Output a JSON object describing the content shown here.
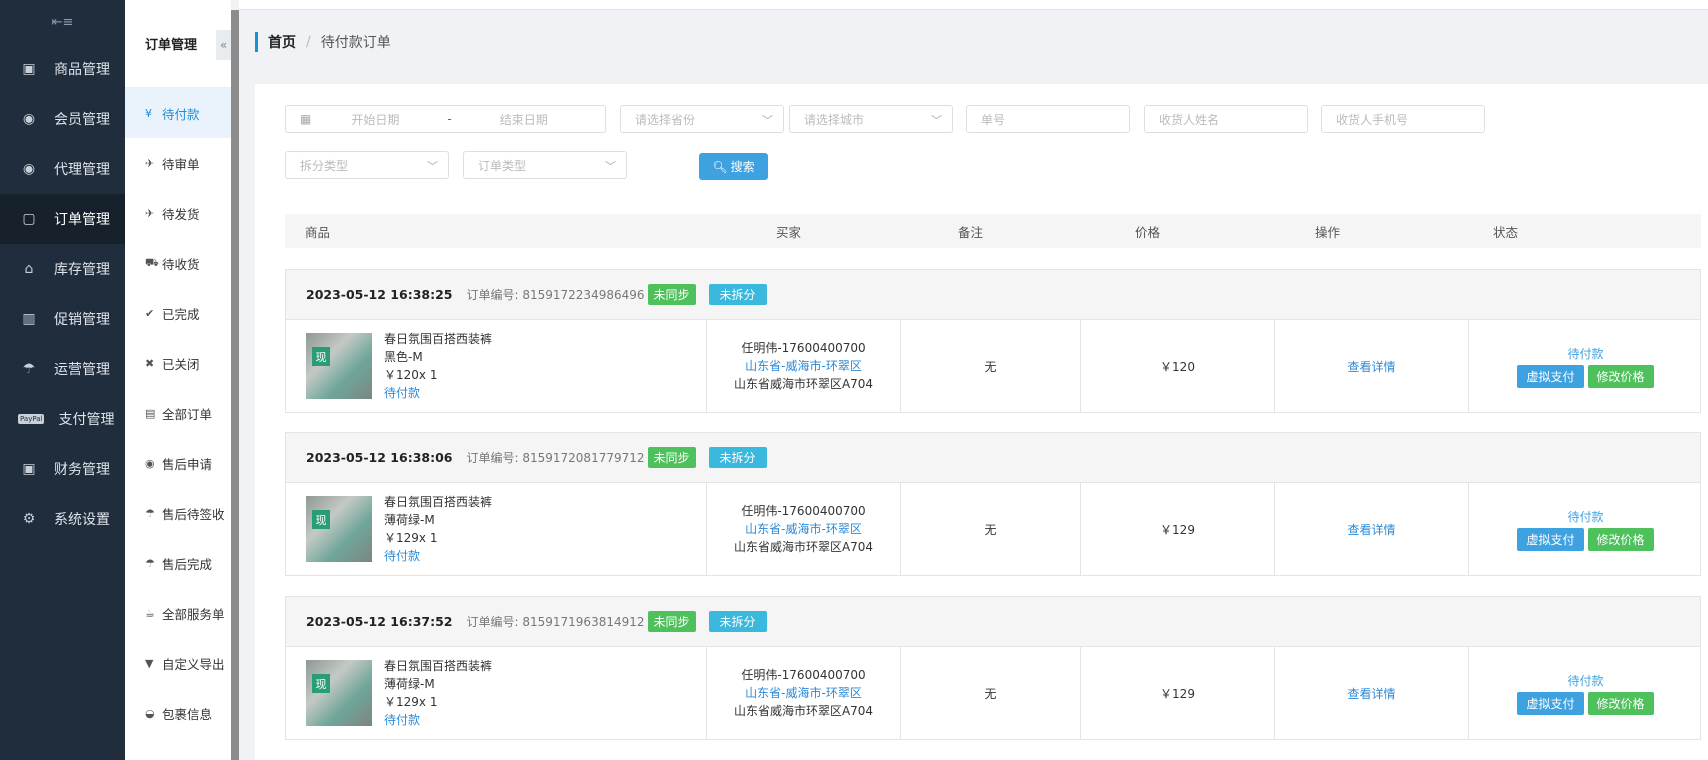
{
  "sidebar": {
    "collapse_icon": "menu-fold-icon",
    "items": [
      {
        "label": "商品管理",
        "icon": "box-icon"
      },
      {
        "label": "会员管理",
        "icon": "user-icon"
      },
      {
        "label": "代理管理",
        "icon": "agent-icon"
      },
      {
        "label": "订单管理",
        "icon": "order-icon"
      },
      {
        "label": "库存管理",
        "icon": "home-icon"
      },
      {
        "label": "促销管理",
        "icon": "gift-icon"
      },
      {
        "label": "运营管理",
        "icon": "umbrella-icon"
      },
      {
        "label": "支付管理",
        "icon": "paypal-icon",
        "icon_text": "PayPal"
      },
      {
        "label": "财务管理",
        "icon": "finance-icon"
      },
      {
        "label": "系统设置",
        "icon": "cogs-icon"
      }
    ]
  },
  "subnav": {
    "title": "订单管理",
    "toggle": "«",
    "items": [
      {
        "label": "待付款",
        "glyph": "¥"
      },
      {
        "label": "待审单",
        "glyph": "✈"
      },
      {
        "label": "待发货",
        "glyph": "✈"
      },
      {
        "label": "待收货",
        "glyph": "⛟"
      },
      {
        "label": "已完成",
        "glyph": "✔"
      },
      {
        "label": "已关闭",
        "glyph": "✖"
      },
      {
        "label": "全部订单",
        "glyph": "▤"
      },
      {
        "label": "售后申请",
        "glyph": "◉"
      },
      {
        "label": "售后待签收",
        "glyph": "☂"
      },
      {
        "label": "售后完成",
        "glyph": "☂"
      },
      {
        "label": "全部服务单",
        "glyph": "☕"
      },
      {
        "label": "自定义导出",
        "glyph": "▼"
      },
      {
        "label": "包裹信息",
        "glyph": "◒"
      }
    ]
  },
  "breadcrumb": {
    "home": "首页",
    "separator": "/",
    "current": "待付款订单"
  },
  "filters": {
    "start_date": "开始日期",
    "end_date": "结束日期",
    "range_dash": "-",
    "province": "请选择省份",
    "city": "请选择城市",
    "order_no": "单号",
    "receiver_name": "收货人姓名",
    "receiver_phone": "收货人手机号",
    "split_type": "拆分类型",
    "order_type": "订单类型",
    "search_label": "搜索"
  },
  "table": {
    "headers": {
      "product": "商品",
      "buyer": "买家",
      "note": "备注",
      "price": "价格",
      "action": "操作",
      "status": "状态"
    }
  },
  "orders": [
    {
      "time": "2023-05-12 16:38:25",
      "order_no_label": "订单编号: 8159172234986496",
      "sync_tag": "未同步",
      "split_tag": "未拆分",
      "thumb_badge": "现",
      "product_name": "春日氛围百搭西装裤",
      "sku": "黑色-M",
      "price_qty": "￥120x 1",
      "pay_status": "待付款",
      "buyer_name": "任明伟-17600400700",
      "buyer_region": "山东省-威海市-环翠区",
      "buyer_address": "山东省威海市环翠区A704",
      "note": "无",
      "price": "￥120",
      "detail_link": "查看详情",
      "status": "待付款",
      "btn_pay": "虚拟支付",
      "btn_edit": "修改价格"
    },
    {
      "time": "2023-05-12 16:38:06",
      "order_no_label": "订单编号: 8159172081779712",
      "sync_tag": "未同步",
      "split_tag": "未拆分",
      "thumb_badge": "现",
      "product_name": "春日氛围百搭西装裤",
      "sku": "薄荷绿-M",
      "price_qty": "￥129x 1",
      "pay_status": "待付款",
      "buyer_name": "任明伟-17600400700",
      "buyer_region": "山东省-威海市-环翠区",
      "buyer_address": "山东省威海市环翠区A704",
      "note": "无",
      "price": "￥129",
      "detail_link": "查看详情",
      "status": "待付款",
      "btn_pay": "虚拟支付",
      "btn_edit": "修改价格"
    },
    {
      "time": "2023-05-12 16:37:52",
      "order_no_label": "订单编号: 8159171963814912",
      "sync_tag": "未同步",
      "split_tag": "未拆分",
      "thumb_badge": "现",
      "product_name": "春日氛围百搭西装裤",
      "sku": "薄荷绿-M",
      "price_qty": "￥129x 1",
      "pay_status": "待付款",
      "buyer_name": "任明伟-17600400700",
      "buyer_region": "山东省-威海市-环翠区",
      "buyer_address": "山东省威海市环翠区A704",
      "note": "无",
      "price": "￥129",
      "detail_link": "查看详情",
      "status": "待付款",
      "btn_pay": "虚拟支付",
      "btn_edit": "修改价格"
    }
  ],
  "colors": {
    "sidebar_bg": "#1f2d3d",
    "accent": "#1a90d6",
    "button_blue": "#3fa2e0",
    "button_green": "#4fc15c",
    "tag_cyan": "#3ab8de"
  }
}
